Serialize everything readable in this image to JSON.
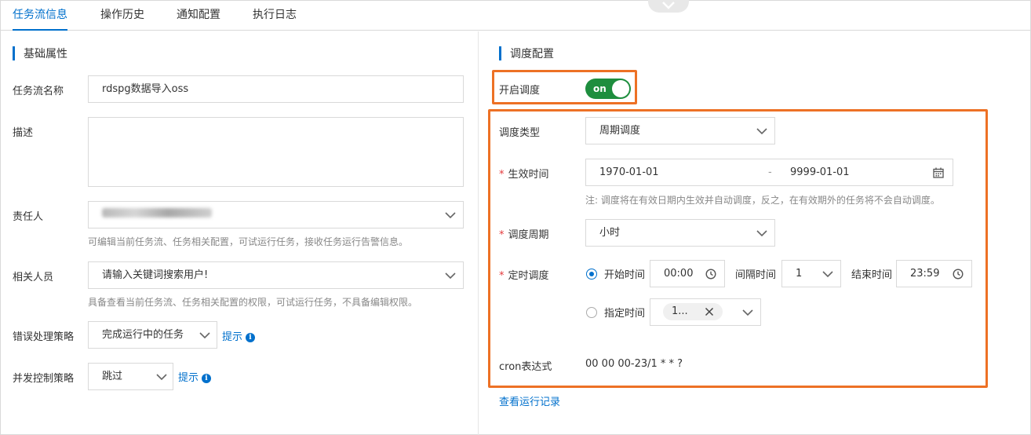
{
  "tabs": [
    "任务流信息",
    "操作历史",
    "通知配置",
    "执行日志"
  ],
  "basic": {
    "title": "基础属性",
    "name_label": "任务流名称",
    "name_value": "rdspg数据导入oss",
    "desc_label": "描述",
    "desc_value": "",
    "owner_label": "责任人",
    "owner_hint": "可编辑当前任务流、任务相关配置，可试运行任务，接收任务运行告警信息。",
    "related_label": "相关人员",
    "related_placeholder": "请输入关键词搜索用户!",
    "related_hint": "具备查看当前任务流、任务相关配置的权限，可试运行任务，不具备编辑权限。",
    "error_label": "错误处理策略",
    "error_value": "完成运行中的任务",
    "concurrency_label": "并发控制策略",
    "concurrency_value": "跳过",
    "tip_label": "提示",
    "tip_label2": "提示"
  },
  "schedule": {
    "title": "调度配置",
    "enable_label": "开启调度",
    "toggle_text": "on",
    "toggle_on": true,
    "type_label": "调度类型",
    "type_value": "周期调度",
    "effective_label": "生效时间",
    "date_start": "1970-01-01",
    "date_sep": "-",
    "date_end": "9999-01-01",
    "effective_note": "注: 调度将在有效日期内生效并自动调度，反之，在有效期外的任务将不会自动调度。",
    "period_label": "调度周期",
    "period_value": "小时",
    "timed_label": "定时调度",
    "start_time_label": "开始时间",
    "start_time_value": "00:00",
    "interval_label": "间隔时间",
    "interval_value": "1",
    "end_time_label": "结束时间",
    "end_time_value": "23:59",
    "specified_label": "指定时间",
    "specified_tag": "1...",
    "cron_label": "cron表达式",
    "cron_value": "00 00 00-23/1 * * ?",
    "view_runs": "查看运行记录"
  },
  "colors": {
    "accent": "#0070cc",
    "highlight": "#ed7125",
    "toggle": "#1e8e3e"
  }
}
